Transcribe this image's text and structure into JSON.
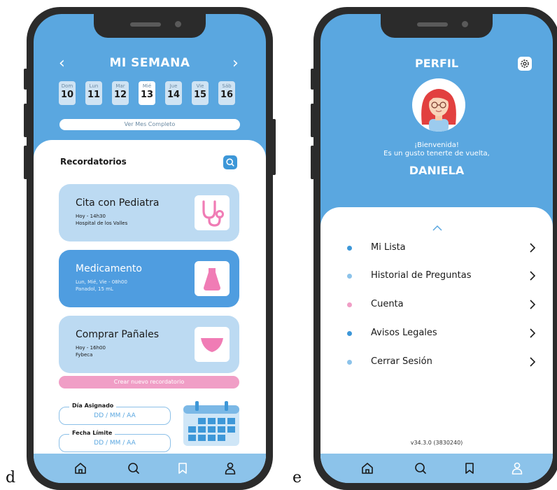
{
  "labels": {
    "d": "d",
    "e": "e"
  },
  "phone_d": {
    "title": "MI SEMANA",
    "prev_arrow": "‹",
    "next_arrow": "›",
    "days": [
      {
        "name": "Dom",
        "num": "10",
        "active": false
      },
      {
        "name": "Lun",
        "num": "11",
        "active": false
      },
      {
        "name": "Mar",
        "num": "12",
        "active": false
      },
      {
        "name": "Mié",
        "num": "13",
        "active": true
      },
      {
        "name": "Jue",
        "num": "14",
        "active": false
      },
      {
        "name": "Vie",
        "num": "15",
        "active": false
      },
      {
        "name": "Sáb",
        "num": "16",
        "active": false
      }
    ],
    "month_button": "Ver Mes Completo",
    "reminders_title": "Recordatorios",
    "search_icon": "search-icon",
    "cards": [
      {
        "title": "Cita con Pediatra",
        "line1": "Hoy - 14h30",
        "line2": "Hospital de los Valles",
        "icon": "stethoscope-icon"
      },
      {
        "title": "Medicamento",
        "line1": "Lun, Mié, Vie - 08h00",
        "line2": "Panadol, 15 mL",
        "icon": "medicine-bottle-icon"
      },
      {
        "title": "Comprar Pañales",
        "line1": "Hoy - 16h00",
        "line2": "Fybeca",
        "icon": "diaper-icon"
      }
    ],
    "create_button": "Crear nuevo recordatorio",
    "assigned_day_label": "Día Asignado",
    "assigned_day_placeholder": "DD / MM / AA",
    "deadline_label": "Fecha Límite",
    "deadline_placeholder": "DD / MM / AA",
    "calendar_icon": "calendar-icon"
  },
  "phone_e": {
    "title": "PERFIL",
    "settings_icon": "gear-icon",
    "welcome_line1": "¡Bienvenida!",
    "welcome_line2": "Es un gusto tenerte de vuelta,",
    "user_name": "DANIELA",
    "menu": [
      {
        "label": "Mi Lista",
        "dot_color": "#3d97d8"
      },
      {
        "label": "Historial de Preguntas",
        "dot_color": "#8cc3ea"
      },
      {
        "label": "Cuenta",
        "dot_color": "#f09ec6"
      },
      {
        "label": "Avisos Legales",
        "dot_color": "#3d97d8"
      },
      {
        "label": "Cerrar Sesión",
        "dot_color": "#8cc3ea"
      }
    ],
    "version": "v34.3.0 (3830240)"
  },
  "tabbar": [
    "home-icon",
    "search-icon",
    "bookmark-icon",
    "user-icon"
  ],
  "colors": {
    "primary": "#5aa7e0",
    "accent_blue": "#3d97d8",
    "light_blue": "#bcdaf2",
    "pink": "#f09ec6",
    "tabbar": "#8cc3ea"
  }
}
